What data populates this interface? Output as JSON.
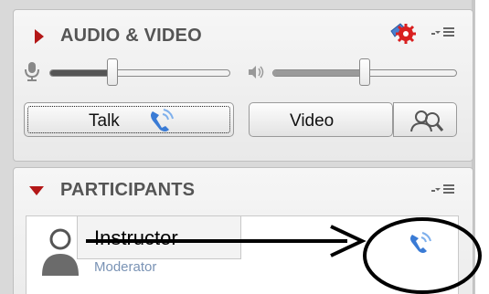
{
  "audio_video": {
    "title": "AUDIO & VIDEO",
    "mic_volume_level": 0.35,
    "speaker_volume_level": 0.5,
    "talk_button_label": "Talk",
    "video_button_label": "Video"
  },
  "participants": {
    "title": "PARTICIPANTS",
    "rows": [
      {
        "name": "Instructor",
        "role": "Moderator"
      }
    ]
  },
  "colors": {
    "section_title": "#555555",
    "collapse_arrow": "#b31717",
    "talking_icon": "#3a7bd5",
    "role_text": "#7a93b5"
  }
}
